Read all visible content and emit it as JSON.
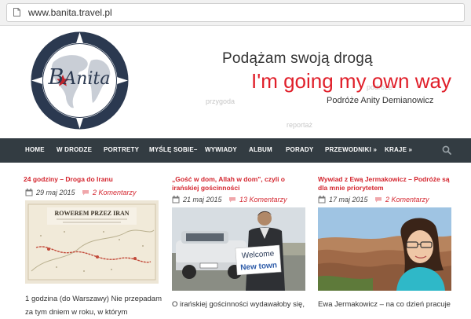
{
  "browser": {
    "url": "www.banita.travel.pl"
  },
  "header": {
    "logo_b": "B",
    "logo_anita": "Anita",
    "tagline_pl": "Podążam swoją drogą",
    "tagline_en": "I'm going my own way",
    "subtitle": "Podróże Anity Demianowicz",
    "ghost_words": [
      "podróże",
      "przygoda",
      "reportaż"
    ]
  },
  "nav": {
    "items": [
      "HOME",
      "W DRODZE",
      "PORTRETY",
      "MYŚLĘ SOBIE–",
      "WYWIADY",
      "ALBUM",
      "PORADY",
      "PRZEWODNIKI »",
      "KRAJE »"
    ]
  },
  "posts": [
    {
      "title": "24 godziny – Droga do Iranu",
      "date": "29 maj 2015",
      "comments": "2 Komentarzy",
      "image_caption_1": "ROWEREM PRZEZ IRAN",
      "excerpt": "1 godzina (do Warszawy) Nie przepadam za tym dniem w roku, w którym"
    },
    {
      "title": "„Gość w dom, Allah w dom\", czyli o irańskiej gościnności",
      "date": "21 maj 2015",
      "comments": "13 Komentarzy",
      "image_caption_1": "Welcome",
      "image_caption_2": "New town",
      "excerpt": "O irańskiej gościnności wydawałoby się,"
    },
    {
      "title": "Wywiad z Ewą Jermakowicz – Podróże są dla mnie priorytetem",
      "date": "17 maj 2015",
      "comments": "2 Komentarzy",
      "excerpt": "Ewa Jermakowicz – na co dzień pracuje"
    }
  ],
  "colors": {
    "accent": "#e01f2a",
    "nav_bg": "#333c42",
    "logo_navy": "#2b3950"
  }
}
